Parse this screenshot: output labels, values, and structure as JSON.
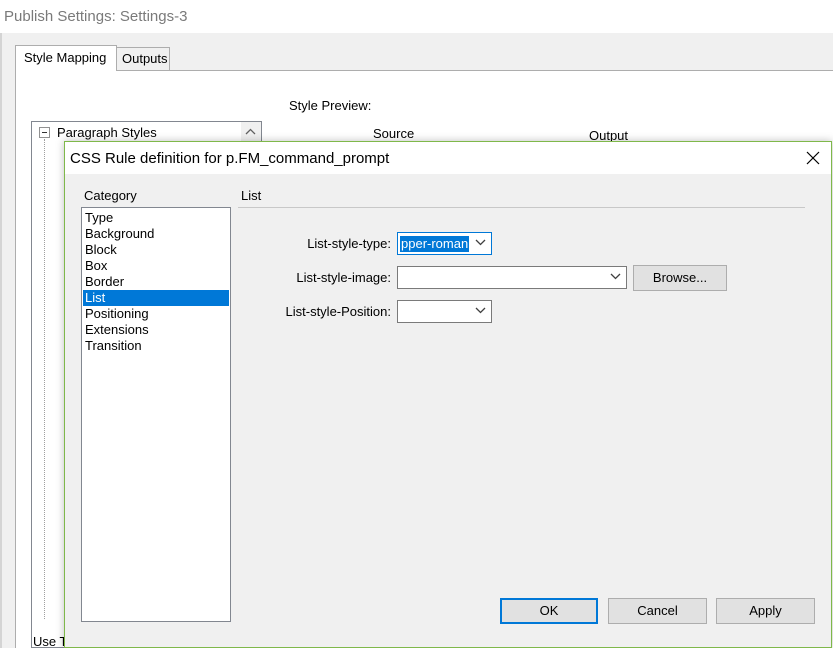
{
  "parent_window": {
    "title": "Publish Settings: Settings-3",
    "tabs": [
      {
        "label": "Style Mapping",
        "active": true
      },
      {
        "label": "Outputs",
        "active": false
      }
    ],
    "style_preview_label": "Style Preview:",
    "preview_columns": {
      "source": "Source",
      "output": "Output"
    },
    "tree_root": "Paragraph Styles",
    "use_label_partial": "Use T"
  },
  "dialog": {
    "title": "CSS Rule definition for p.FM_command_prompt",
    "category_label": "Category",
    "categories": [
      "Type",
      "Background",
      "Block",
      "Box",
      "Border",
      "List",
      "Positioning",
      "Extensions",
      "Transition"
    ],
    "selected_category": "List",
    "section_title": "List",
    "fields": {
      "list_style_type": {
        "label": "List-style-type:",
        "value": "pper-roman"
      },
      "list_style_image": {
        "label": "List-style-image:",
        "value": ""
      },
      "list_style_position": {
        "label": "List-style-Position:",
        "value": ""
      }
    },
    "browse_label": "Browse...",
    "ok_label": "OK",
    "cancel_label": "Cancel",
    "apply_label": "Apply"
  },
  "colors": {
    "selection": "#0078d7",
    "dialog_border": "#7fb84a"
  }
}
